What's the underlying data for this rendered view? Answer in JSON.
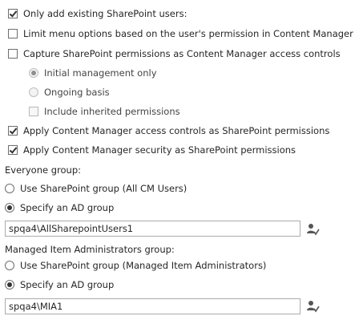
{
  "options": {
    "only_add_existing": {
      "label": "Only add existing SharePoint users:",
      "checked": true
    },
    "limit_menu_options": {
      "label": "Limit menu options based on the user's permission in Content Manager",
      "checked": false
    },
    "capture_permissions": {
      "label": "Capture SharePoint permissions as Content Manager access controls",
      "checked": false
    },
    "initial_management": {
      "label": "Initial management only",
      "selected": true,
      "disabled": true
    },
    "ongoing_basis": {
      "label": "Ongoing basis",
      "selected": false,
      "disabled": true
    },
    "include_inherited": {
      "label": "Include inherited permissions",
      "checked": false,
      "disabled": true
    },
    "apply_access_controls": {
      "label": "Apply Content Manager access controls as SharePoint permissions",
      "checked": true
    },
    "apply_security": {
      "label": "Apply Content Manager security as SharePoint permissions",
      "checked": true
    }
  },
  "everyone_group": {
    "heading": "Everyone group:",
    "use_sharepoint_group": {
      "label": "Use SharePoint group (All CM Users)",
      "selected": false
    },
    "specify_ad_group": {
      "label": "Specify an AD group",
      "selected": true
    },
    "value": "spqa4\\AllSharepointUsers1",
    "picker_icon": "address-book-icon"
  },
  "managed_admins_group": {
    "heading": "Managed Item Administrators group:",
    "use_sharepoint_group": {
      "label": "Use SharePoint group (Managed Item Administrators)",
      "selected": false
    },
    "specify_ad_group": {
      "label": "Specify an AD group",
      "selected": true
    },
    "value": "spqa4\\MIA1",
    "picker_icon": "address-book-icon"
  }
}
